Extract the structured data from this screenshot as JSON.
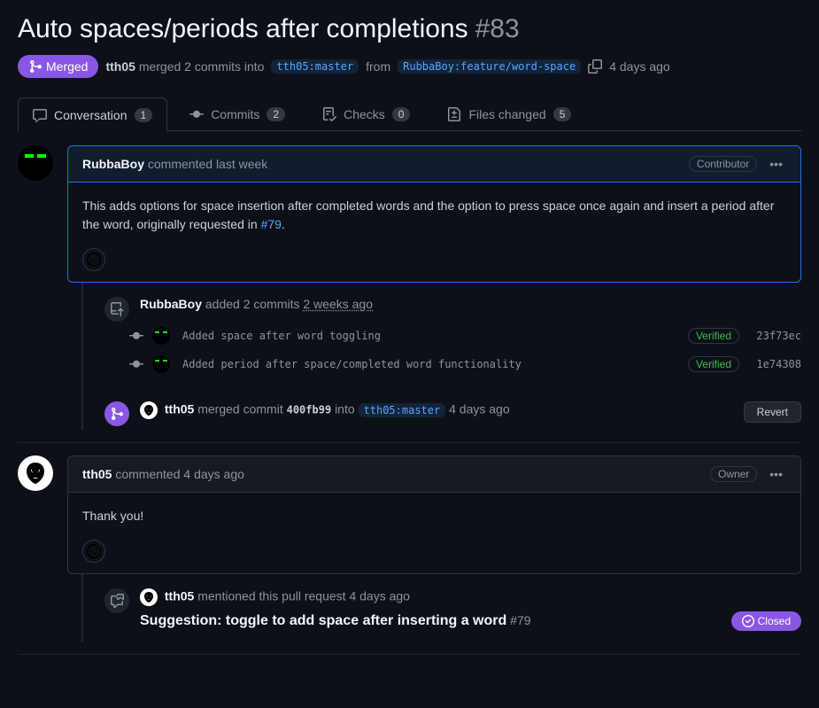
{
  "header": {
    "title": "Auto spaces/periods after completions",
    "number": "#83",
    "state": "Merged",
    "merger": "tth05",
    "meta_pre": "merged 2 commits into",
    "base_branch": "tth05:master",
    "meta_from": "from",
    "compare_branch": "RubbaBoy:feature/word-space",
    "timestamp": "4 days ago"
  },
  "tabs": {
    "conversation": "Conversation",
    "conversation_count": "1",
    "commits": "Commits",
    "commits_count": "2",
    "checks": "Checks",
    "checks_count": "0",
    "files": "Files changed",
    "files_count": "5"
  },
  "comment1": {
    "author": "RubbaBoy",
    "action": "commented",
    "time": "last week",
    "role": "Contributor",
    "body_pre": "This adds options for space insertion after completed words and the option to press space once again and insert a period after the word, originally requested in ",
    "body_link": "#79",
    "body_post": "."
  },
  "event_commits": {
    "author": "RubbaBoy",
    "text": "added 2 commits",
    "time": "2 weeks ago"
  },
  "commits": [
    {
      "msg": "Added space after word toggling",
      "verified": "Verified",
      "sha": "23f73ec"
    },
    {
      "msg": "Added period after space/completed word functionality",
      "verified": "Verified",
      "sha": "1e74308"
    }
  ],
  "event_merge": {
    "author": "tth05",
    "text_pre": "merged commit",
    "sha": "400fb99",
    "text_into": "into",
    "branch": "tth05:master",
    "time": "4 days ago",
    "revert": "Revert"
  },
  "comment2": {
    "author": "tth05",
    "action": "commented",
    "time": "4 days ago",
    "role": "Owner",
    "body": "Thank you!"
  },
  "event_mention": {
    "author": "tth05",
    "text": "mentioned this pull request",
    "time": "4 days ago",
    "issue_title": "Suggestion: toggle to add space after inserting a word",
    "issue_num": "#79",
    "closed": "Closed"
  }
}
